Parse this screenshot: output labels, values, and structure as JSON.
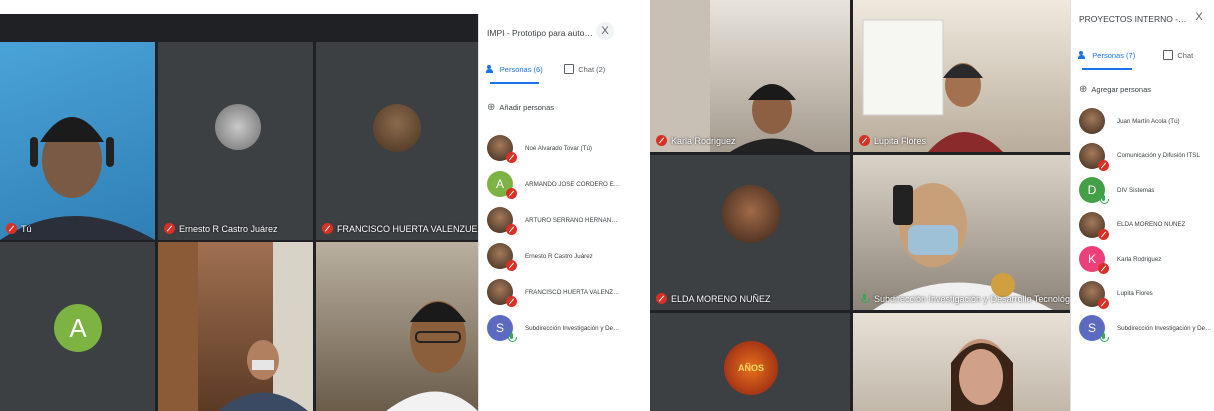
{
  "left": {
    "panel_title": "IMPI - Prototipo para automatizar...",
    "close_label": "X",
    "tabs": {
      "people": "Personas (6)",
      "chat": "Chat (2)"
    },
    "add_people": "Añadir personas",
    "tiles": {
      "self": "Tú",
      "t2": "Ernesto R Castro Juárez",
      "t3": "FRANCISCO HUERTA VALENZUELA",
      "letter_avatar": "A"
    },
    "participants": [
      {
        "name": "Noé Alvarado Tovar (Tú)",
        "type": "photo",
        "mic": "off"
      },
      {
        "name": "ARMANDO JOSE CORDERO ESCAMIL...",
        "type": "letter",
        "letter": "A",
        "color": "#7cb342",
        "mic": "off"
      },
      {
        "name": "ARTURO SERRANO HERNANDEZ",
        "type": "photo",
        "mic": "off"
      },
      {
        "name": "Ernesto R Castro Juárez",
        "type": "photo",
        "mic": "off"
      },
      {
        "name": "FRANCISCO HUERTA VALENZUELA",
        "type": "photo",
        "mic": "off"
      },
      {
        "name": "Subdirección Investigación y Desarrol...",
        "type": "letter",
        "letter": "S",
        "color": "#5c6bc0",
        "mic": "on"
      }
    ]
  },
  "right": {
    "panel_title": "PROYECTOS INTERNO - MUNICIPIO D...",
    "close_label": "X",
    "tabs": {
      "people": "Personas (7)",
      "chat": "Chat"
    },
    "add_people": "Agregar personas",
    "tiles": {
      "t1": "Karla Rodriguez",
      "t2": "Lupita Flores",
      "t3": "ELDA MORENO NUÑEZ",
      "t4": "Subdirección Investigación y Desarrollo Tecnológico",
      "anos": "AÑOS"
    },
    "participants": [
      {
        "name": "Juan Martín Acola (Tú)",
        "type": "photo",
        "mic": "none"
      },
      {
        "name": "Comunicación y Difusión ITSL",
        "type": "photo",
        "mic": "off"
      },
      {
        "name": "DIV Sistemas",
        "type": "letter",
        "letter": "D",
        "color": "#43a047",
        "mic": "dots"
      },
      {
        "name": "ELDA MORENO NUÑEZ",
        "type": "photo",
        "mic": "off"
      },
      {
        "name": "Karla Rodriguez",
        "type": "letter",
        "letter": "K",
        "color": "#ec407a",
        "mic": "off"
      },
      {
        "name": "Lupita Flores",
        "type": "photo",
        "mic": "off"
      },
      {
        "name": "Subdirección Investigación y Desarrol...",
        "type": "letter",
        "letter": "S",
        "color": "#5c6bc0",
        "mic": "on"
      }
    ]
  },
  "colors": {
    "accent": "#1a73e8",
    "muted_red": "#d93025",
    "grid_bg": "#202124"
  }
}
